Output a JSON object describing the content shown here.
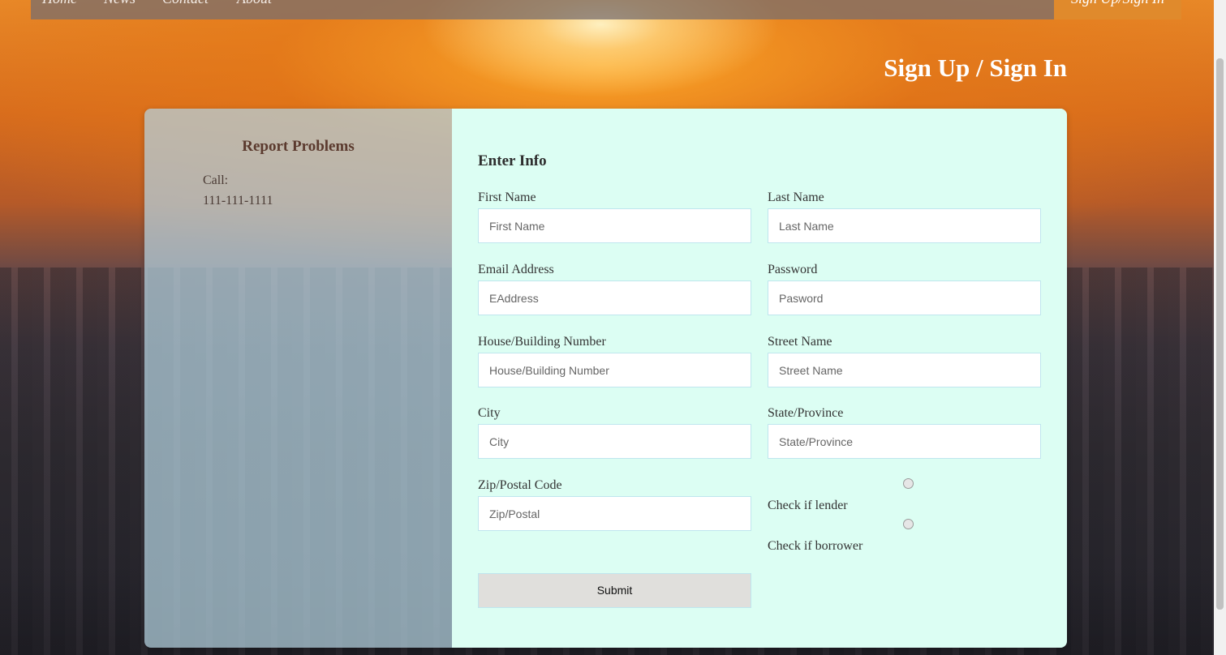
{
  "nav": {
    "links": [
      "Home",
      "News",
      "Contact",
      "About"
    ],
    "cta": "Sign Up/Sign In"
  },
  "page": {
    "heading": "Sign Up / Sign In"
  },
  "report": {
    "title": "Report Problems",
    "call_label": "Call:",
    "phone": "111-111-1111"
  },
  "form": {
    "title": "Enter Info",
    "fields": {
      "first_name": {
        "label": "First Name",
        "placeholder": "First Name"
      },
      "last_name": {
        "label": "Last Name",
        "placeholder": "Last Name"
      },
      "email": {
        "label": "Email Address",
        "placeholder": "EAddress"
      },
      "password": {
        "label": "Password",
        "placeholder": "Pasword"
      },
      "house_number": {
        "label": "House/Building Number",
        "placeholder": "House/Building Number"
      },
      "street_name": {
        "label": "Street Name",
        "placeholder": "Street Name"
      },
      "city": {
        "label": "City",
        "placeholder": "City"
      },
      "state": {
        "label": "State/Province",
        "placeholder": "State/Province"
      },
      "zip": {
        "label": "Zip/Postal Code",
        "placeholder": "Zip/Postal"
      }
    },
    "lender_label": "Check if lender",
    "borrower_label": "Check if borrower",
    "submit": "Submit"
  },
  "colors": {
    "nav_cta": "#e08a2c",
    "form_panel": "#dcfef3",
    "info_panel": "#b4d2e1"
  }
}
